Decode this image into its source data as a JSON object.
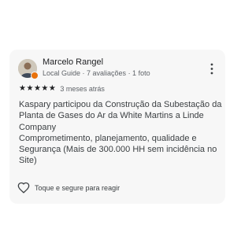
{
  "review": {
    "author_name": "Marcelo Rangel",
    "author_meta": "Local Guide · 7 avaliações · 1 foto",
    "rating": 5,
    "rating_max": 5,
    "time": "3 meses atrás",
    "text_lines": [
      "Kaspary participou da Construção da Subestação da Planta de Gases do Ar da White Martins a Linde Company",
      "Comprometimento, planejamento, qualidade e Segurança (Mais de 300.000 HH sem incidência no Site)"
    ],
    "react_label": "Toque e segure para reagir"
  },
  "icons": {
    "avatar": "user-avatar",
    "badge": "local-guide-badge",
    "menu": "more-vert-icon",
    "star": "star-icon",
    "react": "heart-outline-icon"
  },
  "colors": {
    "card_bg": "#f7f7f7",
    "text_primary": "#202124",
    "text_secondary": "#5f6368",
    "badge": "#e8710a"
  }
}
